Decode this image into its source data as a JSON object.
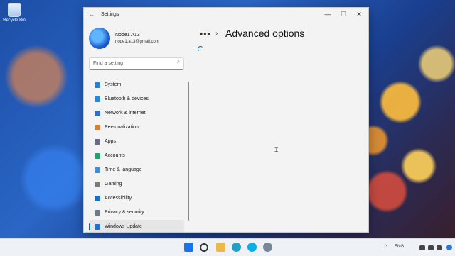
{
  "desktop": {
    "recycle_bin_label": "Recycle Bin"
  },
  "window": {
    "title": "Settings",
    "controls": {
      "minimize": "—",
      "maximize": "☐",
      "close": "✕"
    }
  },
  "profile": {
    "name": "Node1 A13",
    "email": "node1.a13@gmail.com"
  },
  "search": {
    "placeholder": "Find a setting"
  },
  "nav": {
    "items": [
      {
        "label": "System",
        "icon": "system-icon",
        "color": "#2b7bd8"
      },
      {
        "label": "Bluetooth & devices",
        "icon": "bluetooth-icon",
        "color": "#1e88e5"
      },
      {
        "label": "Network & internet",
        "icon": "wifi-icon",
        "color": "#2f6fd1"
      },
      {
        "label": "Personalization",
        "icon": "brush-icon",
        "color": "#e07a2d"
      },
      {
        "label": "Apps",
        "icon": "apps-icon",
        "color": "#6a6a8a"
      },
      {
        "label": "Accounts",
        "icon": "accounts-icon",
        "color": "#20a36d"
      },
      {
        "label": "Time & language",
        "icon": "globe-icon",
        "color": "#3c8ee0"
      },
      {
        "label": "Gaming",
        "icon": "gaming-icon",
        "color": "#7a7a7a"
      },
      {
        "label": "Accessibility",
        "icon": "accessibility-icon",
        "color": "#1b6fc8"
      },
      {
        "label": "Privacy & security",
        "icon": "shield-icon",
        "color": "#6d7a8a"
      },
      {
        "label": "Windows Update",
        "icon": "update-icon",
        "color": "#1a73d9"
      }
    ],
    "active": "Windows Update"
  },
  "content": {
    "breadcrumb_more": "•••",
    "breadcrumb_sep": "›",
    "title": "Advanced options"
  },
  "taskbar": {
    "tray_time": "",
    "lang": "ENG",
    "chevron": "^"
  },
  "colors": {
    "accent": "#0067c0"
  }
}
